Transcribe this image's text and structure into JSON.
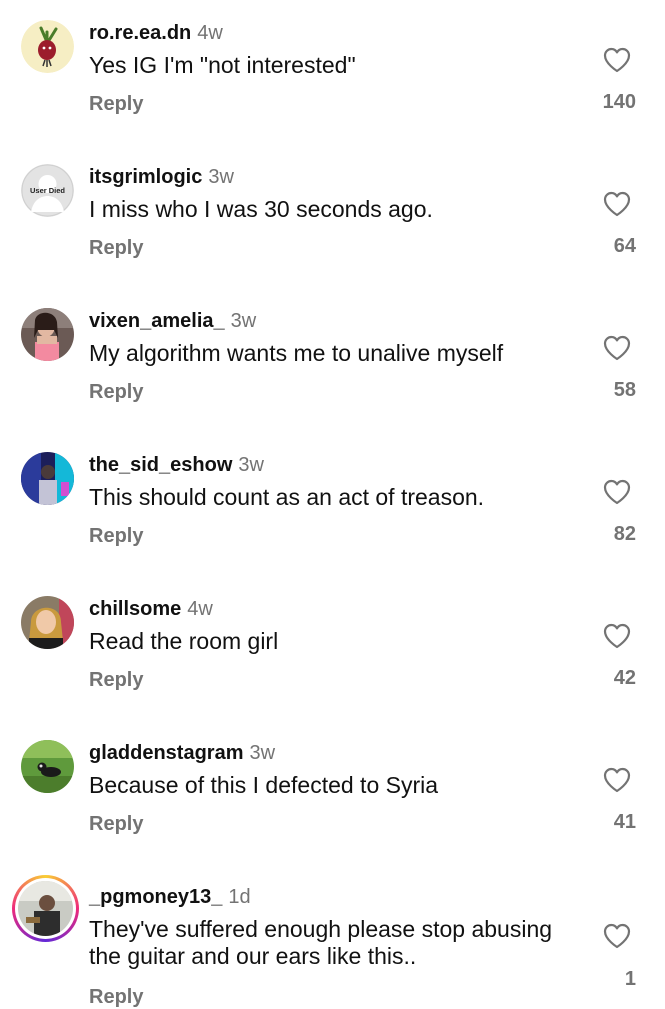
{
  "comments": [
    {
      "username": "ro.re.ea.dn",
      "time": "4w",
      "text": "Yes IG I'm \"not interested\"",
      "reply_label": "Reply",
      "likes": "140",
      "avatar": "beet-icon"
    },
    {
      "username": "itsgrimlogic",
      "time": "3w",
      "text": "I miss who I was 30 seconds ago.",
      "reply_label": "Reply",
      "likes": "64",
      "avatar": "user-died-avatar",
      "avatar_text": "User Died"
    },
    {
      "username": "vixen_amelia_",
      "time": "3w",
      "text": "My algorithm wants me to unalive myself",
      "reply_label": "Reply",
      "likes": "58",
      "avatar": "photo"
    },
    {
      "username": "the_sid_eshow",
      "time": "3w",
      "text": "This should count as an act of treason.",
      "reply_label": "Reply",
      "likes": "82",
      "avatar": "photo"
    },
    {
      "username": "chillsome",
      "time": "4w",
      "text": "Read the room girl",
      "reply_label": "Reply",
      "likes": "42",
      "avatar": "photo"
    },
    {
      "username": "gladdenstagram",
      "time": "3w",
      "text": "Because of this I defected to Syria",
      "reply_label": "Reply",
      "likes": "41",
      "avatar": "photo"
    },
    {
      "username": "_pgmoney13_",
      "time": "1d",
      "text": "They've suffered enough please stop abusing the guitar and our ears like this..",
      "reply_label": "Reply",
      "likes": "1",
      "avatar": "photo-with-story-ring"
    }
  ],
  "colors": {
    "primary_text": "#111111",
    "secondary_text": "#737373",
    "background": "#ffffff"
  }
}
